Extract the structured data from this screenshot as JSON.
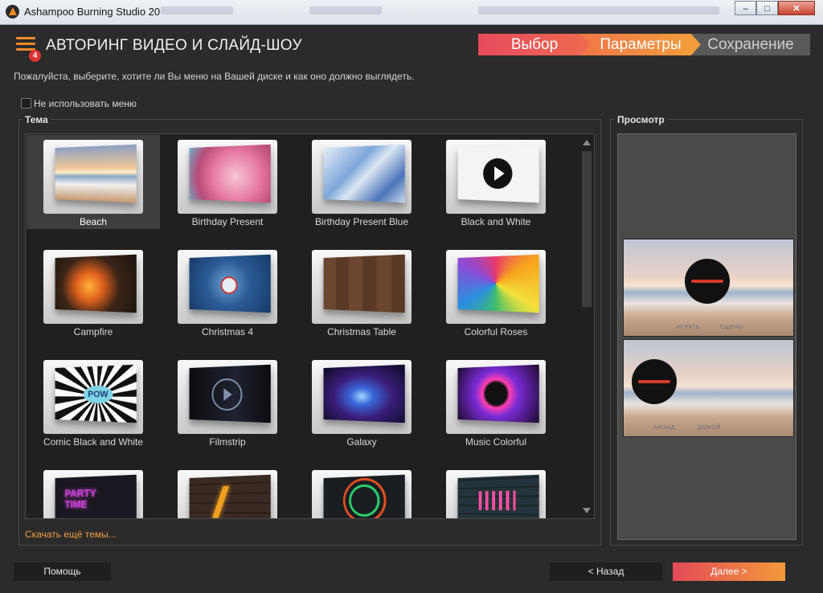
{
  "window": {
    "title": "Ashampoo Burning Studio 20",
    "minimize": "–",
    "maximize": "□",
    "close": "✕"
  },
  "header": {
    "title": "АВТОРИНГ ВИДЕО И СЛАЙД-ШОУ",
    "badge": "4"
  },
  "steps": [
    "Выбор",
    "Параметры",
    "Сохранение"
  ],
  "instruction": "Пожалуйста, выберите, хотите ли Вы меню на Вашей диске и как оно должно выглядеть.",
  "no_menu": {
    "label": "Не использовать меню",
    "checked": false
  },
  "theme_group_label": "Тема",
  "preview_group_label": "Просмотр",
  "selected_theme": "Beach",
  "themes": [
    {
      "name": "Beach"
    },
    {
      "name": "Birthday Present"
    },
    {
      "name": "Birthday Present Blue"
    },
    {
      "name": "Black and White"
    },
    {
      "name": "Campfire"
    },
    {
      "name": "Christmas 4"
    },
    {
      "name": "Christmas Table"
    },
    {
      "name": "Colorful Roses"
    },
    {
      "name": "Comic Black and White"
    },
    {
      "name": "Filmstrip"
    },
    {
      "name": "Galaxy"
    },
    {
      "name": "Music Colorful"
    },
    {
      "name": ""
    },
    {
      "name": ""
    },
    {
      "name": ""
    },
    {
      "name": ""
    }
  ],
  "theme_thumb_text": {
    "comic": "POW",
    "party": "PARTY TIME"
  },
  "more_themes": "Скачать ещё темы...",
  "preview": {
    "page1": {
      "labels": [
        "ИГРАТЬ",
        "СЦЕНЫ"
      ]
    },
    "page2": {
      "labels": [
        "НАЗАД",
        "ДОМОЙ"
      ]
    }
  },
  "buttons": {
    "help": "Помощь",
    "back": "< Назад",
    "next": "Далее >"
  },
  "colors": {
    "accent_orange": "#f08a2c",
    "step_active": "#e64a5c",
    "link": "#f0a040"
  }
}
